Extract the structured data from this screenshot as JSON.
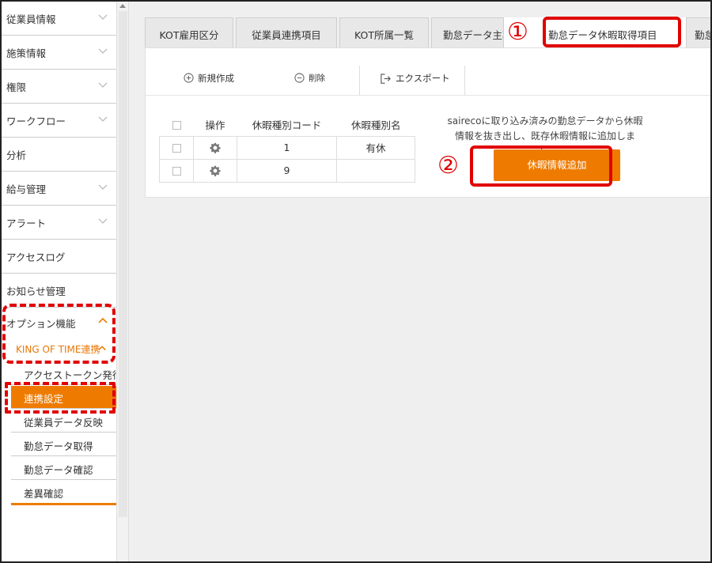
{
  "sidebar": {
    "items": [
      {
        "label": "従業員情報"
      },
      {
        "label": "施策情報"
      },
      {
        "label": "権限"
      },
      {
        "label": "ワークフロー"
      },
      {
        "label": "分析"
      },
      {
        "label": "給与管理"
      },
      {
        "label": "アラート"
      },
      {
        "label": "アクセスログ"
      },
      {
        "label": "お知らせ管理"
      },
      {
        "label": "オプション機能"
      }
    ],
    "sub_group": {
      "label": "KING OF TIME連携"
    },
    "sub_items": [
      {
        "label": "アクセストークン発行"
      },
      {
        "label": "連携設定"
      },
      {
        "label": "従業員データ反映"
      },
      {
        "label": "勤怠データ取得"
      },
      {
        "label": "勤怠データ確認"
      },
      {
        "label": "差異確認"
      }
    ]
  },
  "tabs": [
    {
      "label": "KOT雇用区分"
    },
    {
      "label": "従業員連携項目"
    },
    {
      "label": "KOT所属一覧"
    },
    {
      "label": "勤怠データ主項"
    },
    {
      "label": "勤怠データ休暇取得項目"
    },
    {
      "label": "勤怠"
    }
  ],
  "toolbar": {
    "new_label": "新規作成",
    "delete_label": "削除",
    "export_label": "エクスポート"
  },
  "table": {
    "headers": [
      "操作",
      "休暇種別コード",
      "休暇種別名"
    ],
    "rows": [
      {
        "code": "1",
        "name": "有休"
      },
      {
        "code": "9",
        "name": ""
      }
    ]
  },
  "description": {
    "line1": "sairecoに取り込み済みの勤怠データから休暇",
    "line2": "情報を抜き出し、既存休暇情報に追加します。"
  },
  "add_button_label": "休暇情報追加",
  "annotations": {
    "step1": "①",
    "step2": "②"
  },
  "colors": {
    "accent": "#ee7b00",
    "annotation": "#e00000"
  }
}
